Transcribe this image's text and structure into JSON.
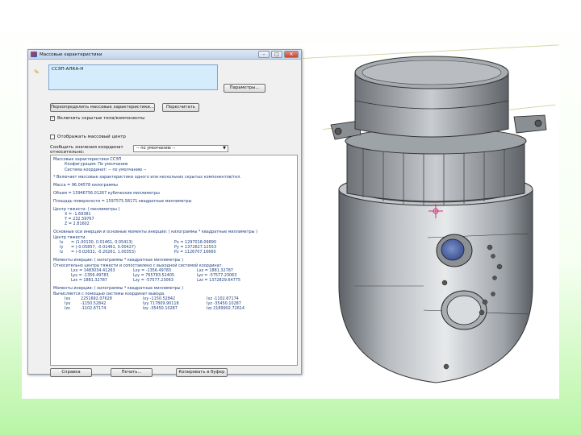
{
  "dialog": {
    "title": "Массовые характеристики",
    "window_buttons": [
      "–",
      "□",
      "✕"
    ],
    "selection_text": "ССЭП-АЛКА-Н",
    "options_button": "Параметры...",
    "recalc_assigned_button": "Переопределить массовые характеристики...",
    "recalc_button": "Пересчитать",
    "include_hidden_label": "Включить скрытые тела/компоненты",
    "include_hidden_checked": true,
    "coord_system_label": "Отображать массовый центр",
    "coord_system_checked": false,
    "report_label": "Сообщить значения координат относительно:",
    "report_value": "-- по умолчанию --",
    "icons": {
      "pencil": "pencil-icon",
      "dropdown": "chevron-down-icon"
    },
    "results": {
      "header": "Массовые характеристики ССЭП",
      "config": "Конфигурация: По умолчанию",
      "coord_sys": "Система координат: -- по умолчанию --",
      "note": "* Включает массовые характеристики одного или нескольких скрытых компонентов/тел.",
      "mass": "Масса = 96.04578 килограммы",
      "volume": "Объем = 15946756.01267 кубические миллиметры",
      "area": "Площадь поверхности = 1597575.58171 квадратные миллиметры",
      "center_header": "Центр тяжести: ( миллиметры )",
      "center": [
        "X = -1.69381",
        "Y = 232.59767",
        "Z = 2.81602"
      ],
      "axes_header": "Основные оси инерции и основные моменты инерции: ( килограммы * квадратные миллиметры )",
      "axes_sub": "Центр тяжести.",
      "axes": [
        [
          "Ix",
          "= (1.00130, 0.01461, 0.05413)",
          "Px = 1297018.09890"
        ],
        [
          "Iy",
          "= (-0.05857, -0.01461, 0.00427)",
          "Py = 1372627.12553"
        ],
        [
          "Iz",
          "= (-0.02632, -0.20261, 1.00353)",
          "Pz = 1126707.16660"
        ]
      ],
      "moments_cg_header": "Моменты инерции: ( килограммы * квадратные миллиметры )",
      "moments_cg_sub": "Относительно центра тяжести и сопоставлено с выходной системой координат.",
      "moments_cg": [
        [
          "Lxx = 1483034.41263",
          "Lxy = -1356.49783",
          "Lxz = 1881.32787"
        ],
        [
          "Lyx = -1356.49783",
          "Lyy = 765783.52405",
          "Lyz = -57577.23063"
        ],
        [
          "Lzx = 1881.32787",
          "Lzy = -57577.23063",
          "Lzz = 1372829.64775"
        ]
      ],
      "moments_out_header": "Моменты инерции: ( килограммы * квадратные миллиметры )",
      "moments_out_sub": "Вычисляется с помощью системы координат вывода.",
      "moments_out": [
        [
          "Ixx",
          "2251692.07628",
          "Ixy",
          "-1150.52842",
          "Ixz",
          "-1102.67174"
        ],
        [
          "Iyx",
          "-1150.52842",
          "Iyy",
          "717809.90118",
          "Iyz",
          "-35450.10287"
        ],
        [
          "Izx",
          "-1102.67174",
          "Izy",
          "-35450.10287",
          "Izz",
          "2189902.72614"
        ]
      ]
    },
    "bottom_buttons": [
      "Справка",
      "Печать...",
      "Копировать в буфер"
    ]
  }
}
